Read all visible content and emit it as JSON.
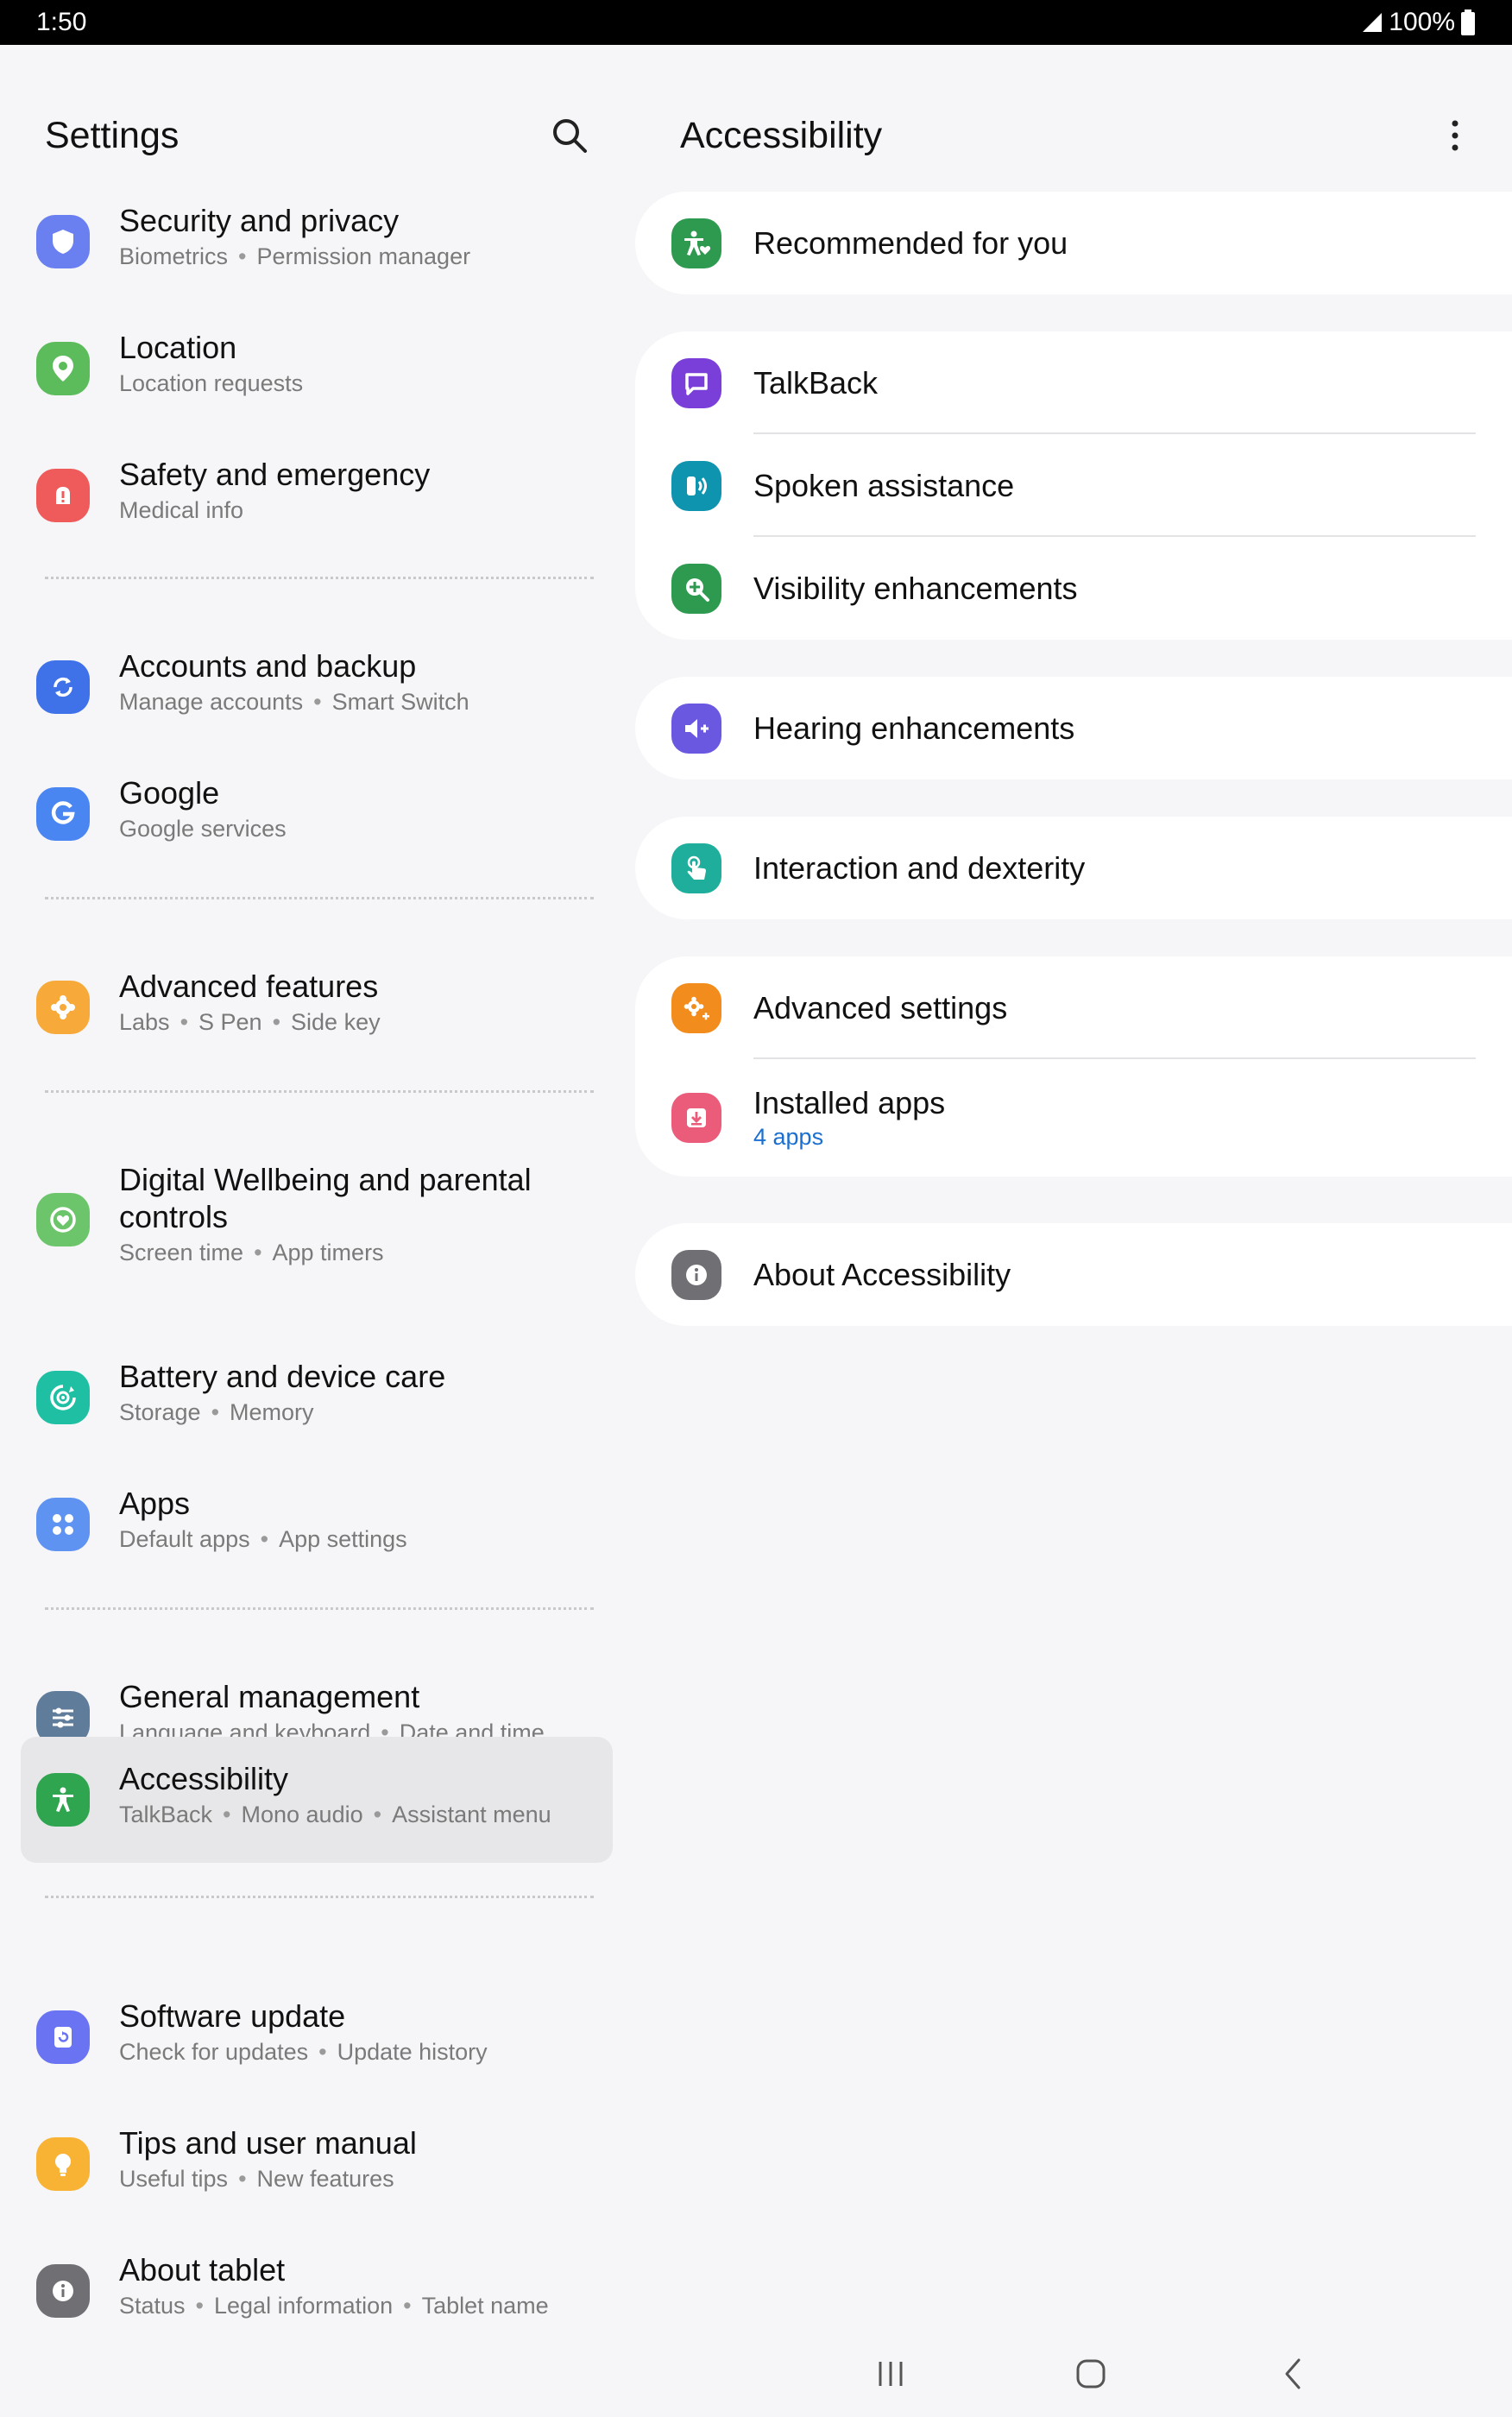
{
  "status_bar": {
    "time": "1:50",
    "battery": "100%"
  },
  "left": {
    "title": "Settings",
    "items": [
      {
        "title": "Security and privacy",
        "subs": [
          "Biometrics",
          "Permission manager"
        ],
        "color": "#6a7ff0"
      },
      {
        "title": "Location",
        "subs": [
          "Location requests"
        ],
        "color": "#5cbb5a"
      },
      {
        "title": "Safety and emergency",
        "subs": [
          "Medical info"
        ],
        "color": "#ef5b5b"
      },
      {
        "title": "Accounts and backup",
        "subs": [
          "Manage accounts",
          "Smart Switch"
        ],
        "color": "#3f72e8"
      },
      {
        "title": "Google",
        "subs": [
          "Google services"
        ],
        "color": "#4a86f2"
      },
      {
        "title": "Advanced features",
        "subs": [
          "Labs",
          "S Pen",
          "Side key"
        ],
        "color": "#f7a93a"
      },
      {
        "title": "Digital Wellbeing and parental controls",
        "subs": [
          "Screen time",
          "App timers"
        ],
        "color": "#6cc56a"
      },
      {
        "title": "Battery and device care",
        "subs": [
          "Storage",
          "Memory"
        ],
        "color": "#1fbfa3"
      },
      {
        "title": "Apps",
        "subs": [
          "Default apps",
          "App settings"
        ],
        "color": "#5e93f2"
      },
      {
        "title": "General management",
        "subs": [
          "Language and keyboard",
          "Date and time"
        ],
        "color": "#5f7c9b"
      },
      {
        "title": "Accessibility",
        "subs": [
          "TalkBack",
          "Mono audio",
          "Assistant menu"
        ],
        "color": "#2fa550"
      },
      {
        "title": "Software update",
        "subs": [
          "Check for updates",
          "Update history"
        ],
        "color": "#6a74f2"
      },
      {
        "title": "Tips and user manual",
        "subs": [
          "Useful tips",
          "New features"
        ],
        "color": "#f8b334"
      },
      {
        "title": "About tablet",
        "subs": [
          "Status",
          "Legal information",
          "Tablet name"
        ],
        "color": "#6f6f74"
      }
    ]
  },
  "right": {
    "title": "Accessibility",
    "cards": [
      {
        "rows": [
          {
            "title": "Recommended for you",
            "color": "#2e9a4f",
            "icon": "accessibility-person-icon"
          }
        ]
      },
      {
        "rows": [
          {
            "title": "TalkBack",
            "color": "#7b3fd9",
            "icon": "talkback-icon"
          },
          {
            "title": "Spoken assistance",
            "color": "#0f94b0",
            "icon": "spoken-assistance-icon"
          },
          {
            "title": "Visibility enhancements",
            "color": "#2e9a4f",
            "icon": "magnifier-plus-icon"
          }
        ]
      },
      {
        "rows": [
          {
            "title": "Hearing enhancements",
            "color": "#6a58e0",
            "icon": "hearing-speaker-icon"
          }
        ]
      },
      {
        "rows": [
          {
            "title": "Interaction and dexterity",
            "color": "#1fae9b",
            "icon": "touch-hand-icon"
          }
        ]
      },
      {
        "rows": [
          {
            "title": "Advanced settings",
            "color": "#f28c1c",
            "icon": "advanced-gear-icon"
          },
          {
            "title": "Installed apps",
            "sub": "4 apps",
            "color": "#ea5c7a",
            "icon": "installed-apps-icon"
          }
        ]
      },
      {
        "rows": [
          {
            "title": "About Accessibility",
            "color": "#6f6f74",
            "icon": "info-icon"
          }
        ]
      }
    ]
  }
}
